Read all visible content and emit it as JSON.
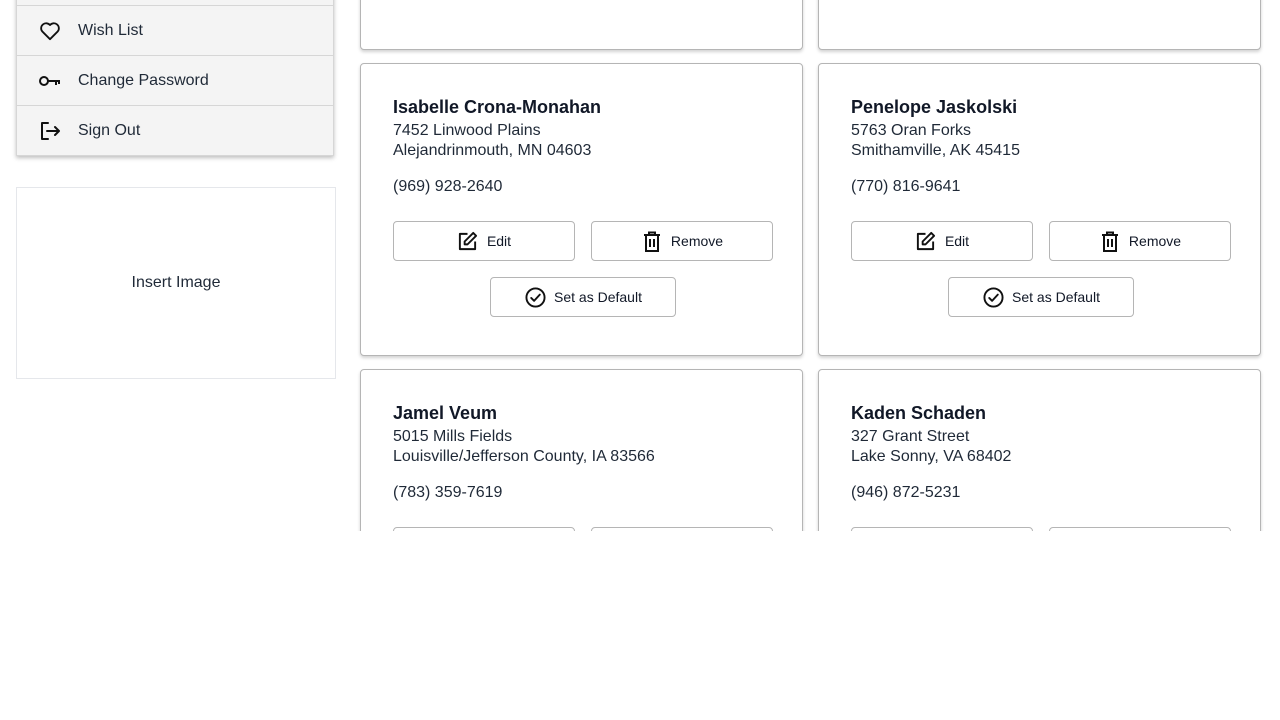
{
  "sidebar": {
    "items": [
      {
        "label": "",
        "icon": "blank"
      },
      {
        "label": "Wish List",
        "icon": "heart-icon"
      },
      {
        "label": "Change Password",
        "icon": "key-icon"
      },
      {
        "label": "Sign Out",
        "icon": "sign-out-icon"
      }
    ],
    "insert_image_label": "Insert Image"
  },
  "buttons": {
    "edit_label": "Edit",
    "remove_label": "Remove",
    "default_label": "Set as Default"
  },
  "addresses": [
    {
      "name": "Isabelle Crona-Monahan",
      "street": "7452 Linwood Plains",
      "city_line": "Alejandrinmouth, MN 04603",
      "phone": "(969) 928-2640"
    },
    {
      "name": "Penelope Jaskolski",
      "street": "5763 Oran Forks",
      "city_line": "Smithamville, AK 45415",
      "phone": "(770) 816-9641"
    },
    {
      "name": "Jamel Veum",
      "street": "5015 Mills Fields",
      "city_line": "Louisville/Jefferson County, IA 83566",
      "phone": "(783) 359-7619"
    },
    {
      "name": "Kaden Schaden",
      "street": "327 Grant Street",
      "city_line": "Lake Sonny, VA 68402",
      "phone": "(946) 872-5231"
    }
  ]
}
